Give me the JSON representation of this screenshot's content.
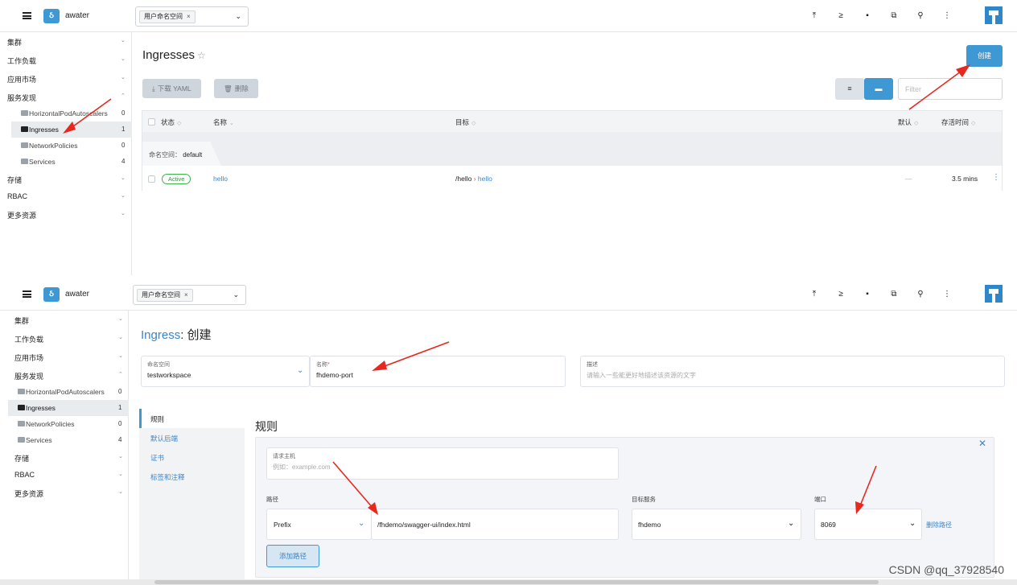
{
  "topbar": {
    "cluster_logo": "ઠ",
    "cluster_name": "awater",
    "namespace_chip": "用户命名空间",
    "chip_close": "×",
    "ns_caret": "⌄",
    "icons": [
      "upload-icon",
      "terminal-icon",
      "file-icon",
      "copy-icon",
      "search-icon",
      "more-vertical-icon"
    ],
    "icon_glyphs": [
      "⤒",
      "≥",
      "▪",
      "⧉",
      "⚲",
      "⋮"
    ]
  },
  "sidebar": {
    "groups": [
      {
        "label": "集群",
        "chevron": "⌄"
      },
      {
        "label": "工作负载",
        "chevron": "⌄"
      },
      {
        "label": "应用市场",
        "chevron": "⌄"
      },
      {
        "label": "服务发现",
        "chevron": "⌃"
      },
      {
        "label": "存储",
        "chevron": "⌄"
      },
      {
        "label": "RBAC",
        "chevron": "⌄"
      },
      {
        "label": "更多资源",
        "chevron": "⌄"
      }
    ],
    "items": [
      {
        "label": "HorizontalPodAutoscalers",
        "count": "0"
      },
      {
        "label": "Ingresses",
        "count": "1"
      },
      {
        "label": "NetworkPolicies",
        "count": "0"
      },
      {
        "label": "Services",
        "count": "4"
      }
    ]
  },
  "list_page": {
    "title": "Ingresses",
    "star": "☆",
    "create_button": "创建",
    "download_yaml": "下载 YAML",
    "download_icon": "⤓",
    "delete_button": "删除",
    "delete_icon": "🗑",
    "view_list_glyph": "≡",
    "view_folder_glyph": "▬",
    "filter_placeholder": "Filter",
    "columns": {
      "status": "状态",
      "name": "名称",
      "target": "目标",
      "default": "默认",
      "age": "存活时间"
    },
    "sort_glyph": "◇",
    "name_sort_glyph": "⌄",
    "group_label": "命名空间：",
    "group_value": "default",
    "row": {
      "status": "Active",
      "name": "hello",
      "target_path": "/hello",
      "target_arrow": "›",
      "target_service": "hello",
      "default": "—",
      "age": "3.5 mins",
      "kebab": "⋮"
    }
  },
  "create_page": {
    "title_resource": "Ingress",
    "title_action": ": 创建",
    "namespace_label": "命名空间",
    "namespace_value": "testworkspace",
    "name_label": "名称",
    "name_required": "*",
    "name_value": "fhdemo-port",
    "desc_label": "描述",
    "desc_placeholder": "请输入一些能更好地描述该资源的文字",
    "tabs": [
      "规则",
      "默认后端",
      "证书",
      "标签和注释"
    ],
    "section_title": "规则",
    "close_glyph": "✕",
    "host_label": "请求主机",
    "host_placeholder": "例如：example.com",
    "path_label": "路径",
    "path_type": "Prefix",
    "path_value": "/fhdemo/swagger-ui/index.html",
    "target_label": "目标服务",
    "target_value": "fhdemo",
    "port_label": "端口",
    "port_value": "8069",
    "remove_path": "删除路径",
    "add_path": "添加路径",
    "caret": "⌄"
  },
  "watermark": "CSDN @qq_37928540",
  "colors": {
    "accent": "#3d98d3",
    "link": "#3d85c6",
    "active_badge": "#3bb54a",
    "annotation_arrow": "#e8281e"
  }
}
